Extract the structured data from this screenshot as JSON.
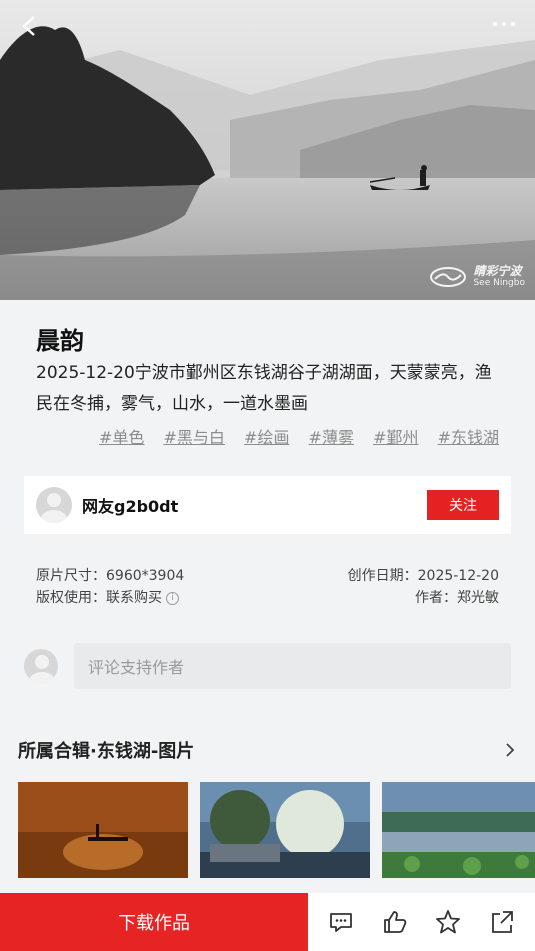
{
  "hero": {
    "back_icon": "back-arrow-icon",
    "more_icon": "more-dots-icon"
  },
  "watermark": {
    "cn": "睛彩宁波",
    "en": "See Ningbo"
  },
  "photo": {
    "title": "晨韵",
    "description": "2025-12-20宁波市鄞州区东钱湖谷子湖湖面，天蒙蒙亮，渔民在冬捕，雾气，山水，一道水墨画",
    "tags": [
      "#单色",
      "#黑与白",
      "#绘画",
      "#薄雾",
      "#鄞州",
      "#东钱湖"
    ]
  },
  "author": {
    "name": "网友g2b0dt",
    "follow_label": "关注"
  },
  "meta": {
    "size_label": "原片尺寸：",
    "size_value": "6960*3904",
    "date_label": "创作日期：",
    "date_value": "2025-12-20",
    "copyright_label": "版权使用：",
    "copyright_value": "联系购买",
    "creator_label": "作者：",
    "creator_value": "郑光敏"
  },
  "comment": {
    "placeholder": "评论支持作者"
  },
  "collection": {
    "title": "所属合辑·东钱湖-图片"
  },
  "bottom": {
    "download_label": "下载作品"
  },
  "colors": {
    "accent": "#e52222",
    "bg": "#f2f3f4"
  }
}
